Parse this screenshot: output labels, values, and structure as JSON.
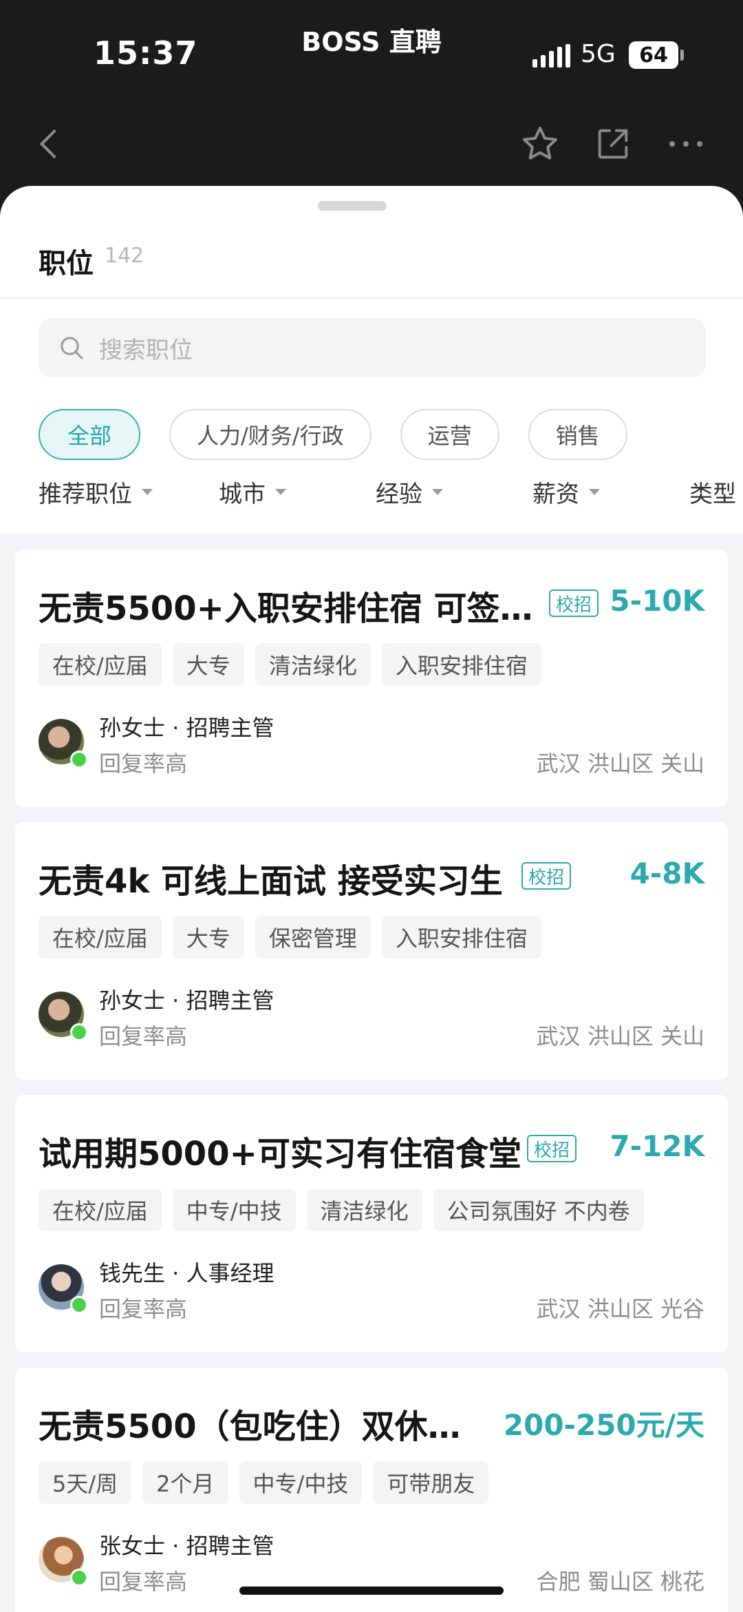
{
  "status_bar": {
    "time": "15:37",
    "app_name": "BOSS 直聘",
    "network": "5G",
    "battery": "64"
  },
  "sheet": {
    "title": "职位",
    "count": "142"
  },
  "search": {
    "placeholder": "搜索职位"
  },
  "chips": [
    "全部",
    "人力/财务/行政",
    "运营",
    "销售"
  ],
  "filters": [
    "推荐职位",
    "城市",
    "经验",
    "薪资",
    "类型"
  ],
  "jobs": [
    {
      "title": "无责5500+入职安排住宿 可签…",
      "badge": "校招",
      "salary": "5-10K",
      "tags": [
        "在校/应届",
        "大专",
        "清洁绿化",
        "入职安排住宿"
      ],
      "recruiter": "孙女士 · 招聘主管",
      "reply": "回复率高",
      "location": "武汉 洪山区 关山"
    },
    {
      "title": "无责4k 可线上面试 接受实习生",
      "badge": "校招",
      "salary": "4-8K",
      "tags": [
        "在校/应届",
        "大专",
        "保密管理",
        "入职安排住宿"
      ],
      "recruiter": "孙女士 · 招聘主管",
      "reply": "回复率高",
      "location": "武汉 洪山区 关山"
    },
    {
      "title": "试用期5000+可实习有住宿食堂",
      "badge": "校招",
      "salary": "7-12K",
      "tags": [
        "在校/应届",
        "中专/中技",
        "清洁绿化",
        "公司氛围好 不内卷"
      ],
      "recruiter": "钱先生 · 人事经理",
      "reply": "回复率高",
      "location": "武汉 洪山区 光谷"
    },
    {
      "title": "无责5500（包吃住）双休…",
      "badge": "",
      "salary": "200-250元/天",
      "tags": [
        "5天/周",
        "2个月",
        "中专/中技",
        "可带朋友"
      ],
      "recruiter": "张女士 · 招聘主管",
      "reply": "回复率高",
      "location": "合肥 蜀山区 桃花"
    }
  ],
  "colors": {
    "accent": "#2aa9ae",
    "online": "#4cd04c"
  },
  "icons": [
    "back-icon",
    "star-icon",
    "share-icon",
    "more-icon",
    "search-icon"
  ]
}
